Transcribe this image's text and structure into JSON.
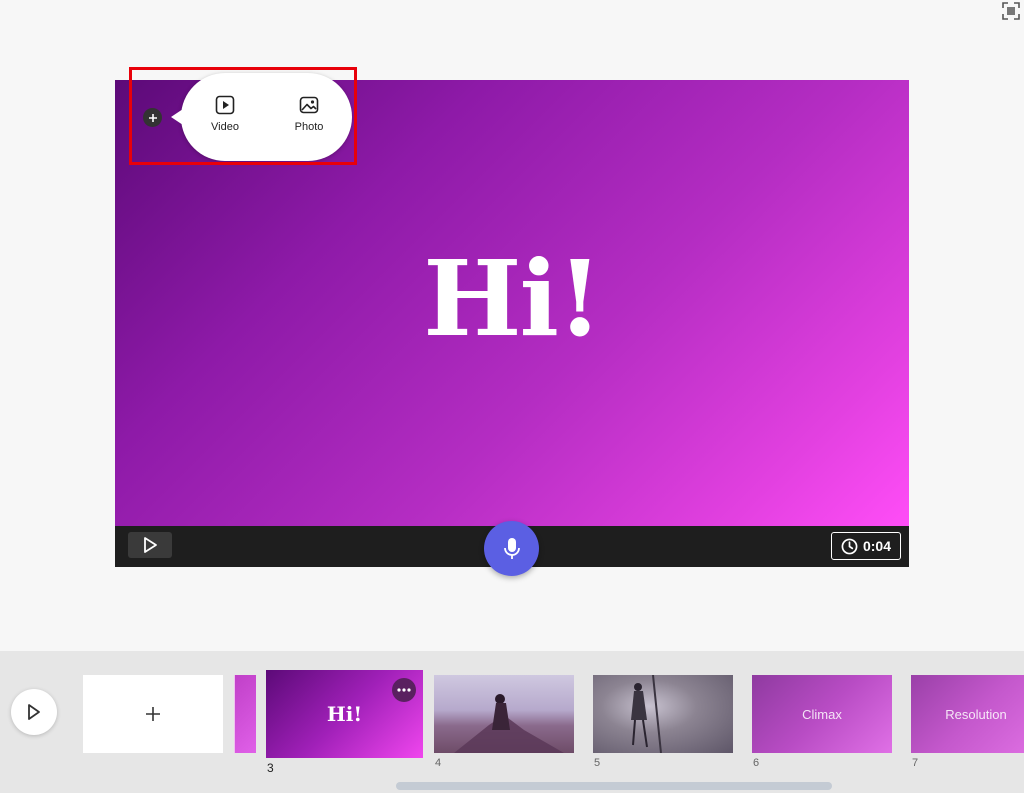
{
  "canvas": {
    "title": "Hi!",
    "duration": "0:04"
  },
  "media_popup": {
    "options": [
      {
        "label": "Video",
        "icon": "video-play-icon"
      },
      {
        "label": "Photo",
        "icon": "image-icon"
      }
    ]
  },
  "timeline": {
    "scenes": [
      {
        "number": "3",
        "title": "Hi!"
      },
      {
        "number": "4"
      },
      {
        "number": "5"
      },
      {
        "number": "6",
        "title": "Climax"
      },
      {
        "number": "7",
        "title": "Resolution"
      }
    ]
  },
  "colors": {
    "mic_button": "#5b5fe3",
    "highlight": "#e8000a",
    "gradient_start": "#5c0a78",
    "gradient_end": "#ff4df7"
  }
}
